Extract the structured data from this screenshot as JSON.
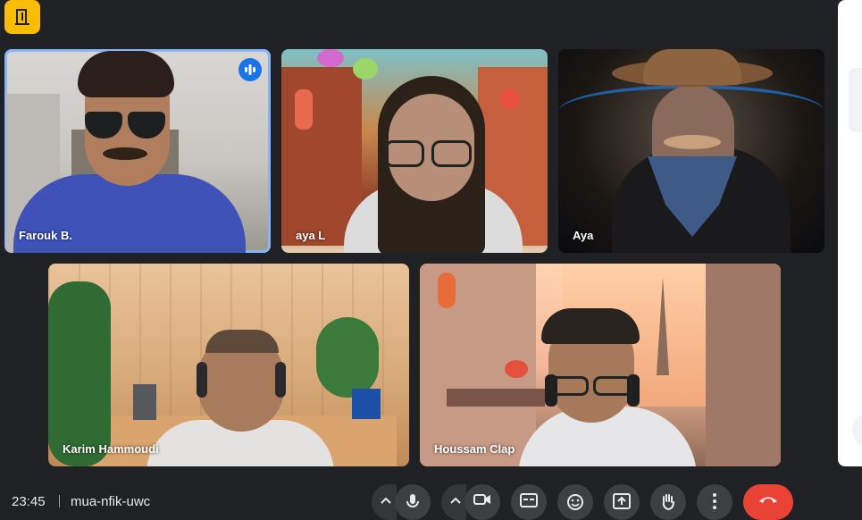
{
  "app": {
    "accent_color": "#8ab4f8",
    "badge_color": "#fbbc04",
    "end_call_color": "#ea4335"
  },
  "participants": [
    {
      "name": "Farouk B.",
      "speaking": true
    },
    {
      "name": "aya L",
      "speaking": false
    },
    {
      "name": "Aya",
      "speaking": false
    },
    {
      "name": "Karim Hammoudi",
      "speaking": false
    },
    {
      "name": "Houssam Clap",
      "speaking": false
    }
  ],
  "bottom_bar": {
    "time": "23:45",
    "meeting_code": "mua-nfik-uwc",
    "controls": [
      {
        "icon": "microphone-icon"
      },
      {
        "icon": "camera-icon"
      },
      {
        "icon": "captions-icon"
      },
      {
        "icon": "emoji-icon"
      },
      {
        "icon": "present-icon"
      },
      {
        "icon": "raise-hand-icon"
      },
      {
        "icon": "more-options-icon"
      },
      {
        "icon": "end-call-icon"
      }
    ]
  }
}
